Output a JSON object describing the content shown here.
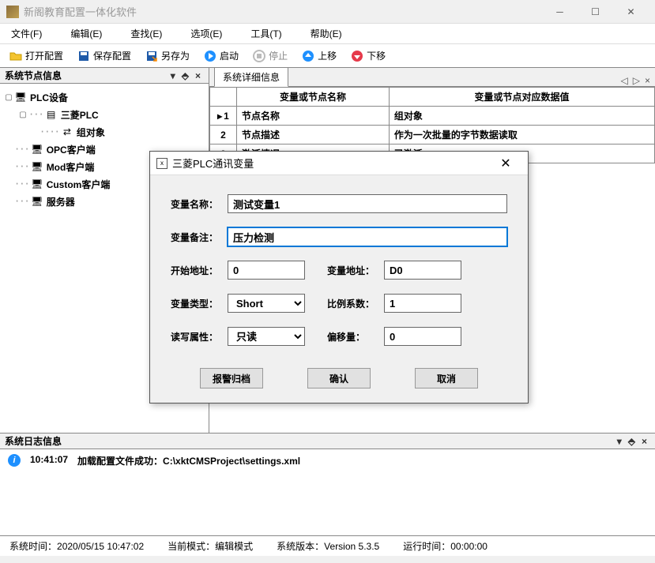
{
  "app": {
    "title": "新阁教育配置一体化软件"
  },
  "menu": {
    "file": "文件(F)",
    "edit": "编辑(E)",
    "find": "查找(E)",
    "option": "选项(E)",
    "tool": "工具(T)",
    "help": "帮助(E)"
  },
  "toolbar": {
    "open": "打开配置",
    "save": "保存配置",
    "saveas": "另存为",
    "start": "启动",
    "stop": "停止",
    "up": "上移",
    "down": "下移"
  },
  "left_panel": {
    "title": "系统节点信息"
  },
  "tree": {
    "root": "PLC设备",
    "mitsubishi": "三菱PLC",
    "group": "组对象",
    "opc": "OPC客户端",
    "mod": "Mod客户端",
    "custom": "Custom客户端",
    "server": "服务器"
  },
  "right_panel": {
    "tab": "系统详细信息",
    "col1": "变量或节点名称",
    "col2": "变量或节点对应数据值",
    "rows": [
      {
        "num": "1",
        "name": "节点名称",
        "val": "组对象"
      },
      {
        "num": "2",
        "name": "节点描述",
        "val": "作为一次批量的字节数据读取"
      },
      {
        "num": "3",
        "name": "激活情况",
        "val": "已激活"
      }
    ]
  },
  "dialog": {
    "title": "三菱PLC通讯变量",
    "name_label": "变量名称：",
    "name_val": "测试变量1",
    "remark_label": "变量备注：",
    "remark_val": "压力检测",
    "start_label": "开始地址：",
    "start_val": "0",
    "addr_label": "变量地址：",
    "addr_val": "D0",
    "type_label": "变量类型：",
    "type_val": "Short",
    "ratio_label": "比例系数：",
    "ratio_val": "1",
    "rw_label": "读写属性：",
    "rw_val": "只读",
    "offset_label": "偏移量：",
    "offset_val": "0",
    "archive": "报警归档",
    "ok": "确认",
    "cancel": "取消"
  },
  "log": {
    "title": "系统日志信息",
    "time": "10:41:07",
    "msg": "加载配置文件成功：C:\\xktCMSProject\\settings.xml"
  },
  "status": {
    "systime_label": "系统时间：",
    "systime": "2020/05/15 10:47:02",
    "mode_label": "当前模式：",
    "mode": "编辑模式",
    "ver_label": "系统版本：",
    "ver": "Version  5.3.5",
    "run_label": "运行时间：",
    "run": "00:00:00"
  }
}
